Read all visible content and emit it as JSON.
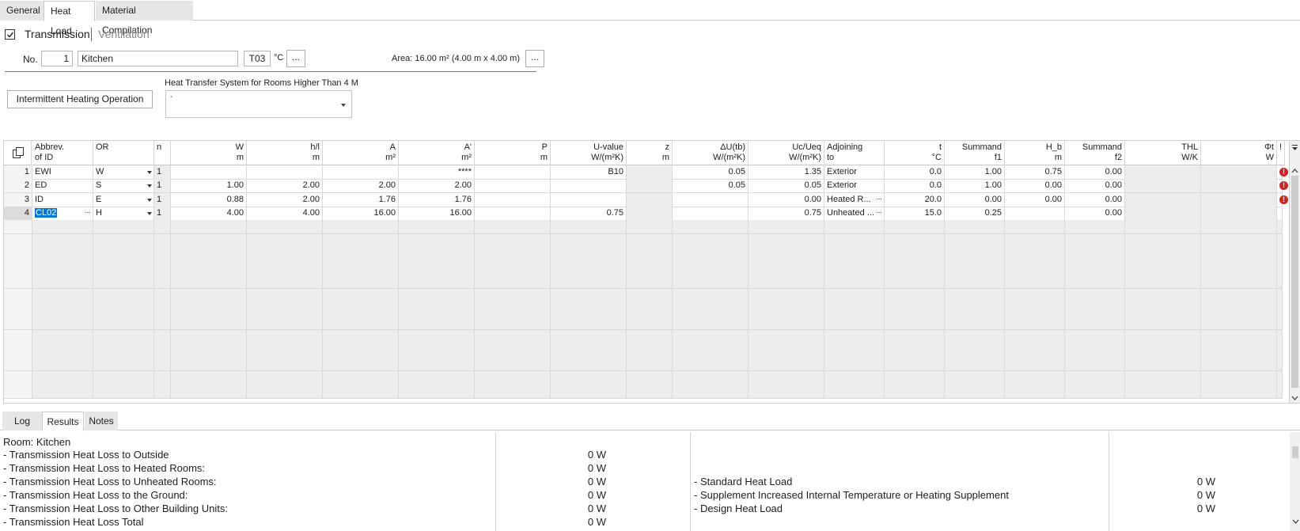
{
  "tabs": [
    "General",
    "Heat Load",
    "Material Compilation"
  ],
  "mode": {
    "checked": true,
    "primary": "Transmission",
    "secondary": "Ventilation"
  },
  "room": {
    "no_label": "No.",
    "no": "1",
    "name": "Kitchen",
    "temp_code": "T03",
    "temp_unit": "°C",
    "more": "...",
    "area_label": "Area: 16.00  m² (4.00 m x 4.00 m)"
  },
  "intermittent_button": "Intermittent Heating Operation",
  "heat_transfer": {
    "label": "Heat Transfer System for Rooms Higher Than 4 M",
    "value": "-"
  },
  "grid": {
    "headers": [
      {
        "line1": "Abbrev.",
        "line2": "of ID"
      },
      {
        "line1": "OR",
        "line2": ""
      },
      {
        "line1": "n",
        "line2": ""
      },
      {
        "line1": "W",
        "line2": "m"
      },
      {
        "line1": "h/l",
        "line2": "m"
      },
      {
        "line1": "A",
        "line2": "m²"
      },
      {
        "line1": "A'",
        "line2": "m²"
      },
      {
        "line1": "P",
        "line2": "m"
      },
      {
        "line1": "U-value",
        "line2": "W/(m²K)"
      },
      {
        "line1": "z",
        "line2": "m"
      },
      {
        "line1": "ΔU(tb)",
        "line2": "W/(m²K)"
      },
      {
        "line1": "Uc/Ueq",
        "line2": "W/(m²K)"
      },
      {
        "line1": "Adjoining",
        "line2": "to"
      },
      {
        "line1": "t",
        "line2": "°C"
      },
      {
        "line1": "Summand",
        "line2": "f1"
      },
      {
        "line1": "H_b",
        "line2": "m"
      },
      {
        "line1": "Summand",
        "line2": "f2"
      },
      {
        "line1": "THL",
        "line2": "W/K"
      },
      {
        "line1": "Φt",
        "line2": "W"
      },
      {
        "line1": "!",
        "line2": ""
      }
    ],
    "rows": [
      {
        "num": "1",
        "cells": [
          "EWI",
          "W",
          "1",
          "",
          "",
          "",
          "****",
          "",
          "B10",
          "",
          "0.05",
          "1.35",
          "Exterior",
          "0.0",
          "1.00",
          "0.75",
          "0.00",
          "",
          "",
          ""
        ]
      },
      {
        "num": "2",
        "cells": [
          "ED",
          "S",
          "1",
          "1.00",
          "2.00",
          "2.00",
          "2.00",
          "",
          "",
          "",
          "0.05",
          "0.05",
          "Exterior",
          "0.0",
          "1.00",
          "0.00",
          "0.00",
          "",
          "",
          ""
        ]
      },
      {
        "num": "3",
        "cells": [
          "ID",
          "E",
          "1",
          "0.88",
          "2.00",
          "1.76",
          "1.76",
          "",
          "",
          "",
          "",
          "0.00",
          "Heated R...",
          "20.0",
          "0.00",
          "0.00",
          "0.00",
          "",
          "",
          ""
        ]
      },
      {
        "num": "4",
        "cells": [
          "CL02",
          "H",
          "1",
          "4.00",
          "4.00",
          "16.00",
          "16.00",
          "",
          "0.75",
          "",
          "",
          "0.75",
          "Unheated ...",
          "15.0",
          "0.25",
          "",
          "0.00",
          "",
          "",
          ""
        ]
      }
    ],
    "error_rows": [
      0,
      1,
      2
    ]
  },
  "bottom_tabs": [
    "Log",
    "Results",
    "Notes"
  ],
  "results": {
    "room_line": "Room: Kitchen",
    "left": [
      {
        "label": "- Transmission Heat Loss to Outside",
        "value": "0 W"
      },
      {
        "label": "- Transmission Heat Loss to Heated Rooms:",
        "value": "0 W"
      },
      {
        "label": "- Transmission Heat Loss to Unheated Rooms:",
        "value": "0 W"
      },
      {
        "label": "- Transmission Heat Loss to the Ground:",
        "value": "0 W"
      },
      {
        "label": "- Transmission Heat Loss to Other Building Units:",
        "value": "0 W"
      },
      {
        "label": "- Transmission Heat Loss Total",
        "value": "0 W"
      }
    ],
    "right": [
      {
        "label": "- Standard Heat Load",
        "value": "0 W"
      },
      {
        "label": "- Supplement Increased Internal Temperature or Heating Supplement",
        "value": "0 W"
      },
      {
        "label": "- Design Heat Load",
        "value": "0 W"
      }
    ]
  }
}
